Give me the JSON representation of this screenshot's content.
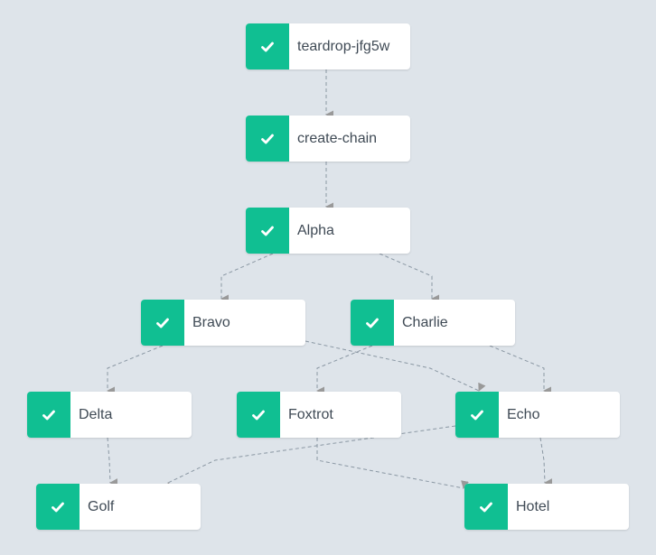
{
  "diagram": {
    "type": "workflow-dag",
    "status_color": "#10bf92",
    "nodes": [
      {
        "id": "teardrop",
        "label": "teardrop-jfg5w",
        "status": "succeeded",
        "icon": "check-icon"
      },
      {
        "id": "create-chain",
        "label": "create-chain",
        "status": "succeeded",
        "icon": "check-icon"
      },
      {
        "id": "alpha",
        "label": "Alpha",
        "status": "succeeded",
        "icon": "check-icon"
      },
      {
        "id": "bravo",
        "label": "Bravo",
        "status": "succeeded",
        "icon": "check-icon"
      },
      {
        "id": "charlie",
        "label": "Charlie",
        "status": "succeeded",
        "icon": "check-icon"
      },
      {
        "id": "delta",
        "label": "Delta",
        "status": "succeeded",
        "icon": "check-icon"
      },
      {
        "id": "foxtrot",
        "label": "Foxtrot",
        "status": "succeeded",
        "icon": "check-icon"
      },
      {
        "id": "echo",
        "label": "Echo",
        "status": "succeeded",
        "icon": "check-icon"
      },
      {
        "id": "golf",
        "label": "Golf",
        "status": "succeeded",
        "icon": "check-icon"
      },
      {
        "id": "hotel",
        "label": "Hotel",
        "status": "succeeded",
        "icon": "check-icon"
      }
    ],
    "edges": [
      {
        "from": "teardrop",
        "to": "create-chain"
      },
      {
        "from": "create-chain",
        "to": "alpha"
      },
      {
        "from": "alpha",
        "to": "bravo"
      },
      {
        "from": "alpha",
        "to": "charlie"
      },
      {
        "from": "bravo",
        "to": "delta"
      },
      {
        "from": "bravo",
        "to": "echo"
      },
      {
        "from": "charlie",
        "to": "foxtrot"
      },
      {
        "from": "charlie",
        "to": "echo"
      },
      {
        "from": "delta",
        "to": "golf"
      },
      {
        "from": "echo",
        "to": "golf"
      },
      {
        "from": "foxtrot",
        "to": "hotel"
      },
      {
        "from": "echo",
        "to": "hotel"
      }
    ]
  }
}
